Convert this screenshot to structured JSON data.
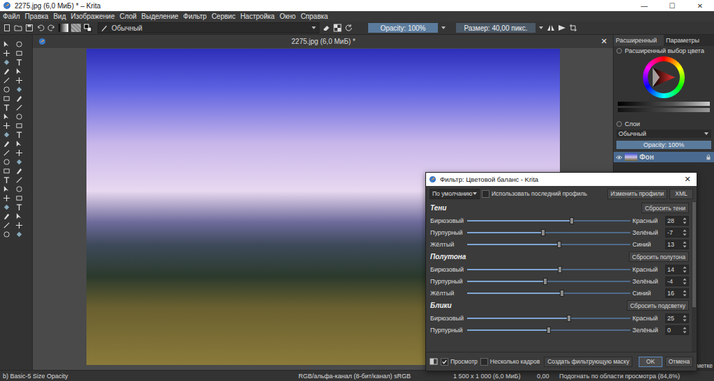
{
  "window": {
    "title": "2275.jpg (6,0 МиБ) * – Krita",
    "controls": [
      "—",
      "☐",
      "✕"
    ]
  },
  "menu": [
    "Файл",
    "Правка",
    "Вид",
    "Изображение",
    "Слой",
    "Выделение",
    "Фильтр",
    "Сервис",
    "Настройка",
    "Окно",
    "Справка"
  ],
  "toolbar": {
    "blend_mode": "Обычный",
    "opacity": {
      "text": "Opacity: 100%",
      "level": 1
    },
    "size": {
      "text": "Размер: 40,00 пикс."
    }
  },
  "document": {
    "tab": "2275.jpg (6,0 МиБ) *",
    "close": "✕"
  },
  "dockers": {
    "tabs": [
      {
        "label": "Расширенный",
        "selected": true
      },
      {
        "label": "Параметры",
        "selected": false
      }
    ],
    "color_selector": {
      "title": "Расширенный выбор цвета"
    },
    "layers": {
      "title": "Слои",
      "blend_mode": "Обычный",
      "opacity": {
        "text": "Opacity: 100%",
        "level": 1
      },
      "items": [
        {
          "name": "Фон",
          "visible": true,
          "selected": true
        }
      ],
      "footer": "метке"
    }
  },
  "dialog": {
    "title": "Фильтр: Цветовой баланс - Krita",
    "close": "✕",
    "profile": "По умолчанию",
    "use_last_profile": {
      "label": "Использовать последний профиль",
      "checked": false
    },
    "edit_profiles": "Изменить профили",
    "xml": "XML",
    "sections": [
      {
        "title": "Тени",
        "reset": "Сбросить тени",
        "rows": [
          {
            "left": "Бирюзовый",
            "right": "Красный",
            "value": "28",
            "level": 0.64
          },
          {
            "left": "Пурпурный",
            "right": "Зелёный",
            "value": "-7",
            "level": 0.465
          },
          {
            "left": "Жёлтый",
            "right": "Синий",
            "value": "13",
            "level": 0.565
          }
        ]
      },
      {
        "title": "Полутона",
        "reset": "Сбросить полутона",
        "rows": [
          {
            "left": "Бирюзовый",
            "right": "Красный",
            "value": "14",
            "level": 0.57
          },
          {
            "left": "Пурпурный",
            "right": "Зелёный",
            "value": "-4",
            "level": 0.48
          },
          {
            "left": "Жёлтый",
            "right": "Синий",
            "value": "16",
            "level": 0.58
          }
        ]
      },
      {
        "title": "Блики",
        "reset": "Сбросить подсветку",
        "rows": [
          {
            "left": "Бирюзовый",
            "right": "Красный",
            "value": "25",
            "level": 0.625
          },
          {
            "left": "Пурпурный",
            "right": "Зелёный",
            "value": "0",
            "level": 0.5
          }
        ]
      }
    ],
    "preview": {
      "label": "Просмотр",
      "checked": true
    },
    "multiple_frames": {
      "label": "Несколько кадров",
      "checked": false
    },
    "create_mask": "Создать фильтрующую маску",
    "ok": "OK",
    "cancel": "Отмена"
  },
  "status_bar": [
    "b) Basic-5 Size Opacity",
    "RGB/альфа-канал (8-бит/канал) sRGB",
    "1 500 x 1 000 (6,0 МиБ)",
    "0,00",
    "Подогнать по области просмотра (84,8%)"
  ]
}
